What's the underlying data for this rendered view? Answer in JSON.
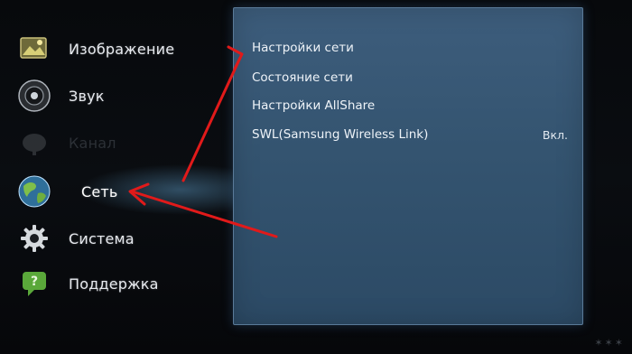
{
  "sidebar": {
    "items": [
      {
        "label": "Изображение",
        "icon": "picture-icon"
      },
      {
        "label": "Звук",
        "icon": "speaker-icon"
      },
      {
        "label": "Канал",
        "icon": "satellite-dish-icon"
      },
      {
        "label": "Сеть",
        "icon": "globe-icon"
      },
      {
        "label": "Система",
        "icon": "gear-icon"
      },
      {
        "label": "Поддержка",
        "icon": "help-bubble-icon"
      }
    ],
    "active_index": 3
  },
  "panel": {
    "items": [
      {
        "label": "Настройки сети",
        "value": ""
      },
      {
        "label": "Состояние сети",
        "value": ""
      },
      {
        "label": "Настройки AllShare",
        "value": ""
      },
      {
        "label": "SWL(Samsung Wireless Link)",
        "value": "Вкл."
      }
    ]
  },
  "annotations": {
    "arrow_color": "#e11a1a"
  },
  "watermark": "✶✶✶"
}
